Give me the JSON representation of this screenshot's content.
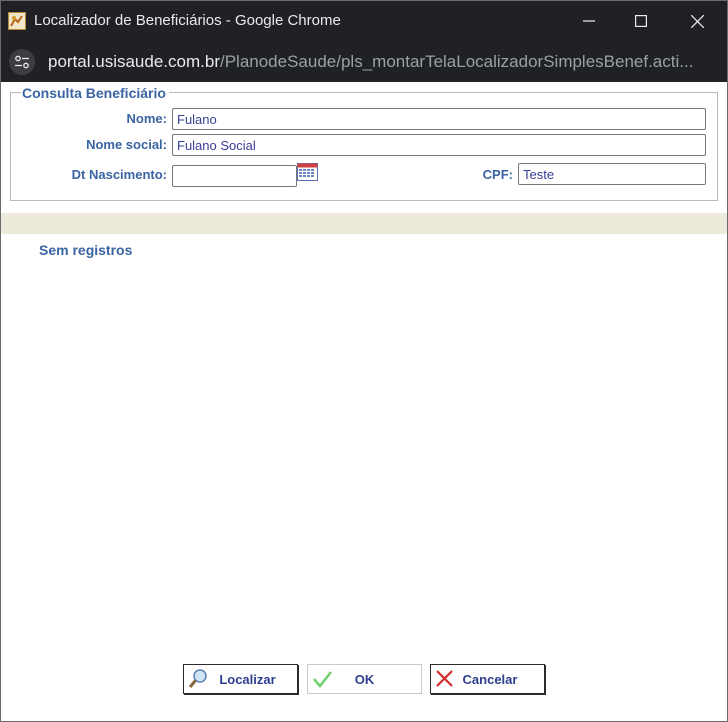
{
  "window": {
    "title": "Localizador de Beneficiários - Google Chrome",
    "url_host": "portal.usisaude.com.br",
    "url_path": "/PlanodeSaude/pls_montarTelaLocalizadorSimplesBenef.acti..."
  },
  "form": {
    "legend": "Consulta Beneficiário",
    "nome": {
      "label": "Nome:",
      "value": "Fulano"
    },
    "nome_social": {
      "label": "Nome social:",
      "value": "Fulano Social"
    },
    "dt_nascimento": {
      "label": "Dt Nascimento:",
      "value": ""
    },
    "cpf": {
      "label": "CPF:",
      "value": "Teste"
    }
  },
  "results": {
    "empty_message": "Sem registros"
  },
  "actions": {
    "localizar": "Localizar",
    "ok": "OK",
    "cancelar": "Cancelar"
  },
  "colors": {
    "label": "#3a64a2",
    "titlebar": "#202124",
    "band": "#edeadc"
  }
}
